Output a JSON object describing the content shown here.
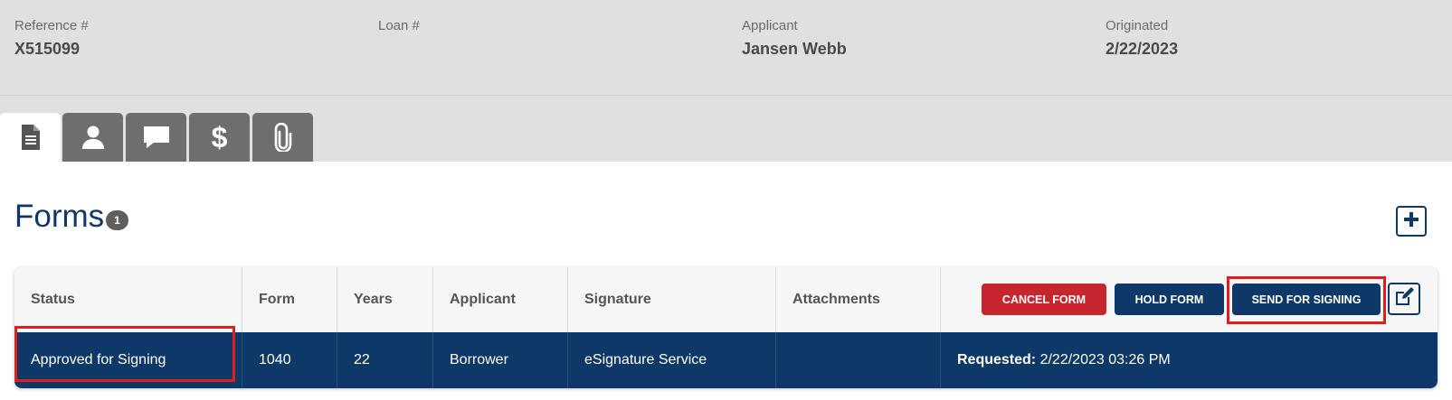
{
  "header": {
    "reference_label": "Reference #",
    "reference_value": "X515099",
    "loan_label": "Loan #",
    "loan_value": "",
    "applicant_label": "Applicant",
    "applicant_value": "Jansen Webb",
    "originated_label": "Originated",
    "originated_value": "2/22/2023"
  },
  "tabs": [
    {
      "icon": "document-icon",
      "active": true
    },
    {
      "icon": "user-icon",
      "active": false
    },
    {
      "icon": "comment-icon",
      "active": false
    },
    {
      "icon": "dollar-icon",
      "active": false
    },
    {
      "icon": "paperclip-icon",
      "active": false
    }
  ],
  "forms": {
    "title": "Forms",
    "count": "1"
  },
  "table": {
    "columns": [
      "Status",
      "Form",
      "Years",
      "Applicant",
      "Signature",
      "Attachments"
    ],
    "actions": {
      "cancel_label": "CANCEL FORM",
      "hold_label": "HOLD FORM",
      "send_label": "SEND FOR SIGNING"
    },
    "rows": [
      {
        "status": "Approved for Signing",
        "form": "1040",
        "years": "22",
        "applicant": "Borrower",
        "signature": "eSignature Service",
        "attachments": "",
        "requested_label": "Requested:",
        "requested_value": "2/22/2023 03:26 PM"
      }
    ]
  },
  "colors": {
    "navy": "#0d3868",
    "red": "#c8262e",
    "highlight": "#e01e1e",
    "header_bg": "#e0e0e0"
  }
}
